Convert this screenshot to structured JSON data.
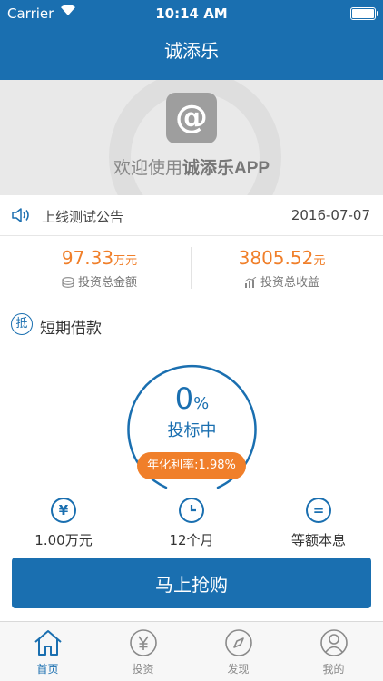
{
  "status_bar": {
    "carrier": "Carrier",
    "time": "10:14 AM"
  },
  "header": {
    "title": "诚添乐"
  },
  "banner": {
    "welcome_prefix": "欢迎使用",
    "welcome_brand": "诚添乐APP"
  },
  "notice": {
    "title": "上线测试公告",
    "date": "2016-07-07"
  },
  "stats": {
    "total_invest": {
      "amount": "97.33",
      "unit": "万元",
      "label": "投资总金额"
    },
    "total_income": {
      "amount": "3805.52",
      "unit": "元",
      "label": "投资总收益"
    }
  },
  "product": {
    "badge": "抵",
    "name": "短期借款",
    "progress_value": "0",
    "progress_unit": "%",
    "progress_fraction": 0,
    "status": "投标中",
    "rate_label": "年化利率:1.98%",
    "features": [
      {
        "icon": "yen-icon",
        "glyph": "¥",
        "text": "1.00万元"
      },
      {
        "icon": "clock-icon",
        "glyph": "",
        "text": "12个月"
      },
      {
        "icon": "equal-icon",
        "glyph": "=",
        "text": "等额本息"
      }
    ],
    "buy_label": "马上抢购"
  },
  "tabs": [
    {
      "label": "首页",
      "icon": "home-icon",
      "active": true
    },
    {
      "label": "投资",
      "icon": "yen-circle-icon",
      "active": false
    },
    {
      "label": "发现",
      "icon": "compass-icon",
      "active": false
    },
    {
      "label": "我的",
      "icon": "user-icon",
      "active": false
    }
  ],
  "colors": {
    "primary": "#1a6fb0",
    "accent": "#f07f2a"
  }
}
